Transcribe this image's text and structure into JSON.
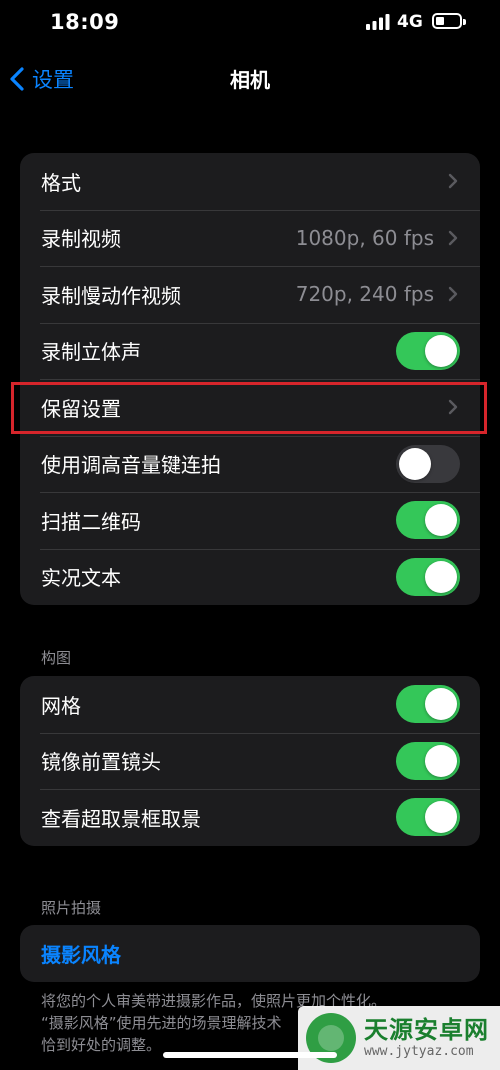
{
  "status_bar": {
    "time": "18:09",
    "network": "4G",
    "battery_level": 0.35
  },
  "nav": {
    "back_label": "设置",
    "title": "相机"
  },
  "main_group": {
    "rows": [
      {
        "label": "格式",
        "value": "",
        "control": "chevron"
      },
      {
        "label": "录制视频",
        "value": "1080p, 60 fps",
        "control": "chevron"
      },
      {
        "label": "录制慢动作视频",
        "value": "720p, 240 fps",
        "control": "chevron"
      },
      {
        "label": "录制立体声",
        "control": "toggle",
        "on": true
      },
      {
        "label": "保留设置",
        "value": "",
        "control": "chevron",
        "highlighted": true
      },
      {
        "label": "使用调高音量键连拍",
        "control": "toggle",
        "on": false
      },
      {
        "label": "扫描二维码",
        "control": "toggle",
        "on": true
      },
      {
        "label": "实况文本",
        "control": "toggle",
        "on": true
      }
    ]
  },
  "composition_section": {
    "header": "构图",
    "rows": [
      {
        "label": "网格",
        "control": "toggle",
        "on": true
      },
      {
        "label": "镜像前置镜头",
        "control": "toggle",
        "on": true
      },
      {
        "label": "查看超取景框取景",
        "control": "toggle",
        "on": true
      }
    ]
  },
  "photo_section": {
    "header": "照片拍摄",
    "styles_label": "摄影风格",
    "footer_lines": [
      "将您的个人审美带进摄影作品，使照片更加个性化。",
      "“摄影风格”使用先进的场景理解技术",
      "恰到好处的调整。"
    ]
  },
  "watermark": {
    "title": "天源安卓网",
    "url": "www.jytyaz.com"
  },
  "colors": {
    "accent": "#0a84ff",
    "toggle_on": "#34c759",
    "toggle_off": "#39393d",
    "cell_background": "#1c1c1e",
    "highlight_box": "#d6252b"
  }
}
